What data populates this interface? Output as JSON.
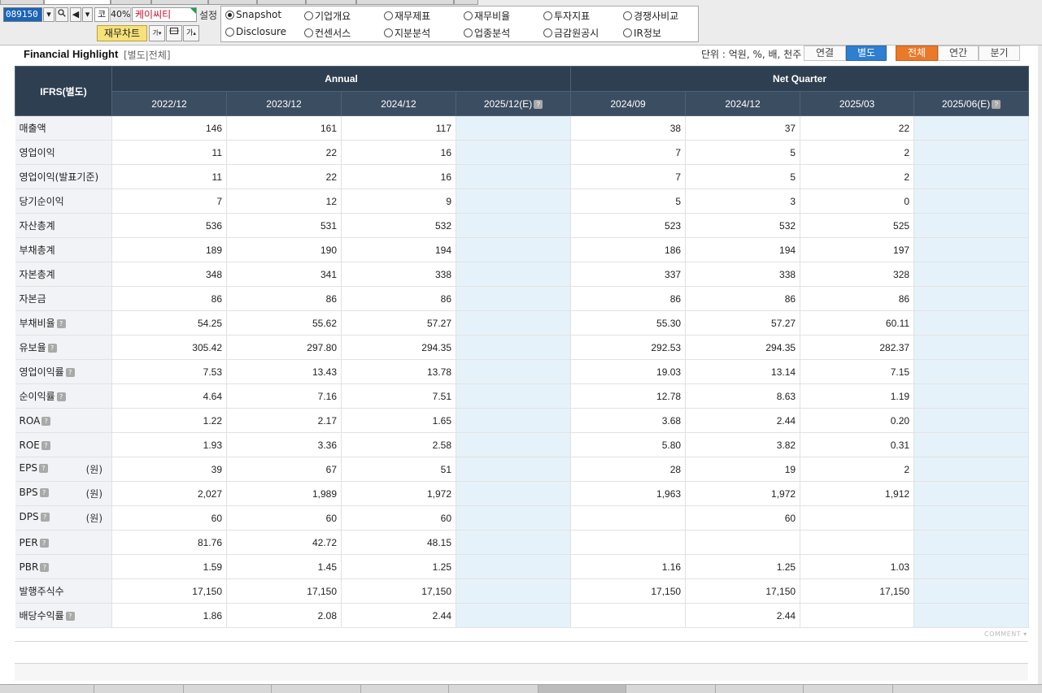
{
  "toolbar": {
    "code": "089150",
    "market_label": "코",
    "ratio": "40%",
    "company_name": "케이씨티",
    "settings_label": "설정",
    "chart_button": "재무차트",
    "font_icon_label": "가"
  },
  "radio_options": [
    {
      "label": "Snapshot",
      "selected": true
    },
    {
      "label": "기업개요",
      "selected": false
    },
    {
      "label": "재무제표",
      "selected": false
    },
    {
      "label": "재무비율",
      "selected": false
    },
    {
      "label": "투자지표",
      "selected": false
    },
    {
      "label": "경쟁사비교",
      "selected": false
    },
    {
      "label": "Disclosure",
      "selected": false
    },
    {
      "label": "컨센서스",
      "selected": false
    },
    {
      "label": "지분분석",
      "selected": false
    },
    {
      "label": "업종분석",
      "selected": false
    },
    {
      "label": "금감원공시",
      "selected": false
    },
    {
      "label": "IR정보",
      "selected": false
    }
  ],
  "section": {
    "title": "Financial Highlight",
    "subtitle": "[별도|전체]",
    "unit": "단위 : 억원, %, 배, 천주",
    "consolidated": "연결",
    "separate": "별도",
    "all": "전체",
    "annual": "연간",
    "quarter": "분기"
  },
  "table": {
    "row_header": "IFRS(별도)",
    "group_annual": "Annual",
    "group_quarter": "Net Quarter",
    "columns": [
      "2022/12",
      "2023/12",
      "2024/12",
      "2025/12(E)",
      "2024/09",
      "2024/12",
      "2025/03",
      "2025/06(E)"
    ],
    "rows": [
      {
        "label": "매출액",
        "help": false,
        "unit": "",
        "values": [
          "146",
          "161",
          "117",
          "",
          "38",
          "37",
          "22",
          ""
        ]
      },
      {
        "label": "영업이익",
        "help": false,
        "unit": "",
        "values": [
          "11",
          "22",
          "16",
          "",
          "7",
          "5",
          "2",
          ""
        ]
      },
      {
        "label": "영업이익(발표기준)",
        "help": false,
        "unit": "",
        "values": [
          "11",
          "22",
          "16",
          "",
          "7",
          "5",
          "2",
          ""
        ]
      },
      {
        "label": "당기순이익",
        "help": false,
        "unit": "",
        "values": [
          "7",
          "12",
          "9",
          "",
          "5",
          "3",
          "0",
          ""
        ]
      },
      {
        "label": "자산총계",
        "help": false,
        "unit": "",
        "values": [
          "536",
          "531",
          "532",
          "",
          "523",
          "532",
          "525",
          ""
        ]
      },
      {
        "label": "부채총계",
        "help": false,
        "unit": "",
        "values": [
          "189",
          "190",
          "194",
          "",
          "186",
          "194",
          "197",
          ""
        ]
      },
      {
        "label": "자본총계",
        "help": false,
        "unit": "",
        "values": [
          "348",
          "341",
          "338",
          "",
          "337",
          "338",
          "328",
          ""
        ]
      },
      {
        "label": "자본금",
        "help": false,
        "unit": "",
        "values": [
          "86",
          "86",
          "86",
          "",
          "86",
          "86",
          "86",
          ""
        ]
      },
      {
        "label": "부채비율",
        "help": true,
        "unit": "",
        "values": [
          "54.25",
          "55.62",
          "57.27",
          "",
          "55.30",
          "57.27",
          "60.11",
          ""
        ]
      },
      {
        "label": "유보율",
        "help": true,
        "unit": "",
        "values": [
          "305.42",
          "297.80",
          "294.35",
          "",
          "292.53",
          "294.35",
          "282.37",
          ""
        ]
      },
      {
        "label": "영업이익률",
        "help": true,
        "unit": "",
        "values": [
          "7.53",
          "13.43",
          "13.78",
          "",
          "19.03",
          "13.14",
          "7.15",
          ""
        ]
      },
      {
        "label": "순이익률",
        "help": true,
        "unit": "",
        "values": [
          "4.64",
          "7.16",
          "7.51",
          "",
          "12.78",
          "8.63",
          "1.19",
          ""
        ]
      },
      {
        "label": "ROA",
        "help": true,
        "unit": "",
        "values": [
          "1.22",
          "2.17",
          "1.65",
          "",
          "3.68",
          "2.44",
          "0.20",
          ""
        ]
      },
      {
        "label": "ROE",
        "help": true,
        "unit": "",
        "values": [
          "1.93",
          "3.36",
          "2.58",
          "",
          "5.80",
          "3.82",
          "0.31",
          ""
        ]
      },
      {
        "label": "EPS",
        "help": true,
        "unit": "(원)",
        "values": [
          "39",
          "67",
          "51",
          "",
          "28",
          "19",
          "2",
          ""
        ]
      },
      {
        "label": "BPS",
        "help": true,
        "unit": "(원)",
        "values": [
          "2,027",
          "1,989",
          "1,972",
          "",
          "1,963",
          "1,972",
          "1,912",
          ""
        ]
      },
      {
        "label": "DPS",
        "help": true,
        "unit": "(원)",
        "values": [
          "60",
          "60",
          "60",
          "",
          "",
          "60",
          "",
          ""
        ]
      },
      {
        "label": "PER",
        "help": true,
        "unit": "",
        "values": [
          "81.76",
          "42.72",
          "48.15",
          "",
          "",
          "",
          "",
          ""
        ]
      },
      {
        "label": "PBR",
        "help": true,
        "unit": "",
        "values": [
          "1.59",
          "1.45",
          "1.25",
          "",
          "1.16",
          "1.25",
          "1.03",
          ""
        ]
      },
      {
        "label": "발행주식수",
        "help": false,
        "unit": "",
        "values": [
          "17,150",
          "17,150",
          "17,150",
          "",
          "17,150",
          "17,150",
          "17,150",
          ""
        ]
      },
      {
        "label": "배당수익률",
        "help": true,
        "unit": "",
        "values": [
          "1.86",
          "2.08",
          "2.44",
          "",
          "",
          "2.44",
          "",
          ""
        ]
      }
    ]
  },
  "comment_label": "COMMENT",
  "help_icon_glyph": "?",
  "colors": {
    "header_bg": "#2f3f52",
    "estimate_bg": "#e6f2fa",
    "active_blue": "#2f7fd0",
    "active_orange": "#ea7a2a",
    "name_red": "#c8102e"
  }
}
